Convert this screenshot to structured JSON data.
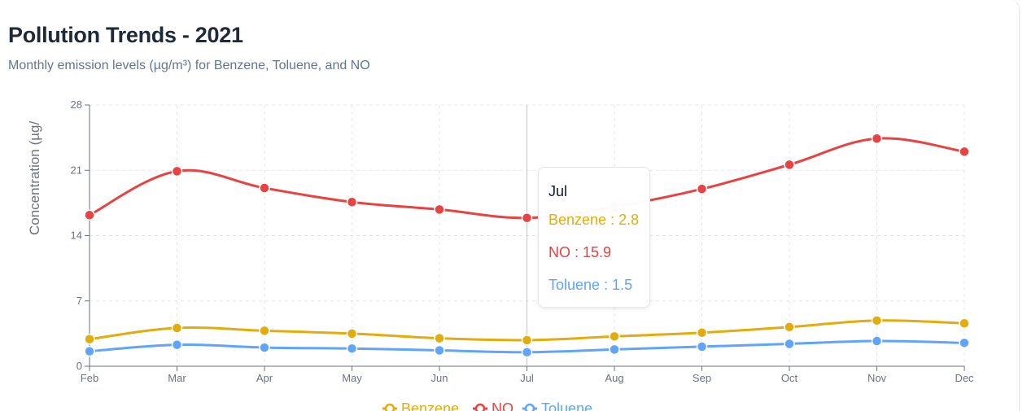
{
  "header": {
    "title": "Pollution Trends - 2021",
    "subtitle": "Monthly emission levels (µg/m³) for Benzene, Toluene, and NO"
  },
  "tooltip": {
    "label": "Jul",
    "rows": [
      {
        "text": "Benzene : 2.8",
        "color": "#e3ac0e"
      },
      {
        "text": "NO : 15.9",
        "color": "#e84343"
      },
      {
        "text": "Toluene : 1.5",
        "color": "#60a5fa"
      }
    ]
  },
  "chart_data": {
    "type": "line",
    "categories": [
      "Feb",
      "Mar",
      "Apr",
      "May",
      "Jun",
      "Jul",
      "Aug",
      "Sep",
      "Oct",
      "Nov",
      "Dec"
    ],
    "series": [
      {
        "name": "Benzene",
        "color": "#e3ac0e",
        "values": [
          2.9,
          4.1,
          3.8,
          3.5,
          3.0,
          2.8,
          3.2,
          3.6,
          4.2,
          4.9,
          4.6
        ]
      },
      {
        "name": "NO",
        "color": "#e84343",
        "values": [
          16.2,
          20.9,
          19.1,
          17.6,
          16.8,
          15.9,
          17.1,
          19.0,
          21.6,
          24.4,
          23.0
        ]
      },
      {
        "name": "Toluene",
        "color": "#60a5fa",
        "values": [
          1.6,
          2.3,
          2.0,
          1.9,
          1.7,
          1.5,
          1.8,
          2.1,
          2.4,
          2.7,
          2.5
        ]
      }
    ],
    "ylabel": "Concentration (µg/",
    "ylim": [
      0,
      28
    ],
    "yticks": [
      "0",
      "7",
      "14",
      "21",
      "28"
    ],
    "grid": true,
    "legend": "bottom-center",
    "active_category": "Jul"
  }
}
